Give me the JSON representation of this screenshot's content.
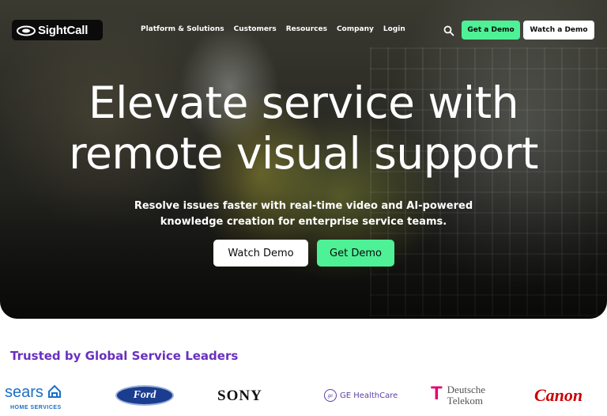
{
  "nav": {
    "logo_text": "SightCall",
    "links": [
      "Platform & Solutions",
      "Customers",
      "Resources",
      "Company",
      "Login"
    ],
    "search_icon": "search-icon",
    "cta_primary": "Get a Demo",
    "cta_secondary": "Watch a Demo"
  },
  "hero": {
    "headline_line1": "Elevate service with",
    "headline_line2": "remote visual support",
    "subtext_line1": "Resolve issues faster with real-time video and AI-powered",
    "subtext_line2": "knowledge creation for enterprise service teams.",
    "watch_button": "Watch Demo",
    "get_button": "Get Demo"
  },
  "trusted": {
    "heading": "Trusted by Global Service Leaders",
    "logos": {
      "sears": "sears",
      "sears_sub": "HOME SERVICES",
      "ford": "Ford",
      "sony": "SONY",
      "ge": "GE HealthCare",
      "deutsche_line1": "Deutsche",
      "deutsche_line2": "Telekom",
      "deutsche_mark": "T",
      "canon": "Canon"
    }
  },
  "colors": {
    "accent_green": "#4ef196",
    "trusted_purple": "#6a2fbf"
  }
}
